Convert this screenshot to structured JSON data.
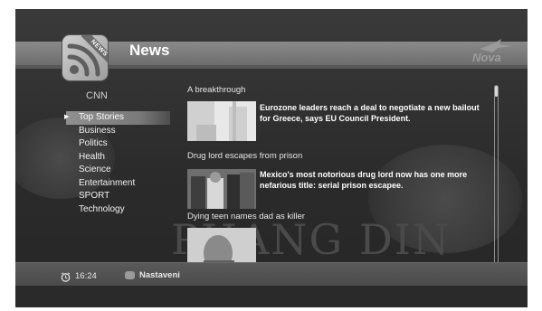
{
  "header": {
    "title": "News",
    "app_icon_label": "NEWS",
    "brand_logo": "Nova"
  },
  "sidebar": {
    "source": "CNN",
    "categories": [
      {
        "label": "Top Stories",
        "selected": true
      },
      {
        "label": "Business"
      },
      {
        "label": "Politics"
      },
      {
        "label": "Health"
      },
      {
        "label": "Science"
      },
      {
        "label": "Entertainment"
      },
      {
        "label": "SPORT"
      },
      {
        "label": "Technology"
      }
    ]
  },
  "news": {
    "items": [
      {
        "headline": "A breakthrough",
        "summary": "Eurozone leaders reach a deal to negotiate a new bailout for Greece, says EU Council President."
      },
      {
        "headline": "Drug lord escapes from prison",
        "summary": "Mexico's most notorious drug lord now has one more nefarious title: serial prison escapee."
      },
      {
        "headline": "Dying teen names dad as killer",
        "summary": ""
      }
    ]
  },
  "background_text": "PHANG DIN",
  "footer": {
    "time": "16:24",
    "settings_label": "Nastaveni"
  },
  "colors": {
    "background": "#2b2b2b",
    "header_band": "#7a7a7a",
    "selection": "#8f8f8f",
    "text": "#ffffff"
  },
  "icons": [
    "rss-icon",
    "bird-logo-icon",
    "clock-icon",
    "settings-icon",
    "selection-arrow-icon"
  ]
}
